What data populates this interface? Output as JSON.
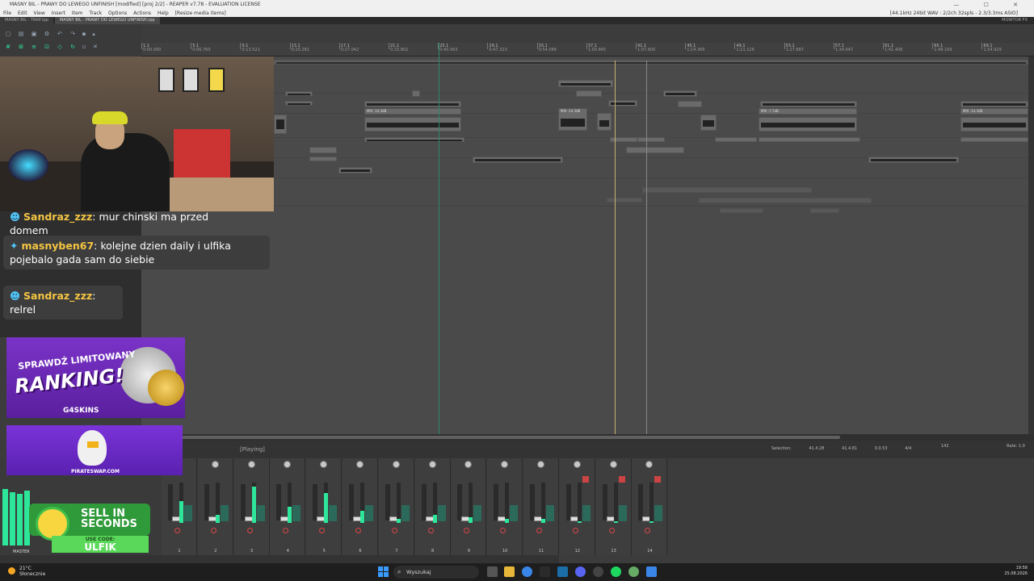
{
  "window": {
    "title": "MASNY BIL - PRAWY DO LEWEGO UNFINISH [modified] [proj 2/2] - REAPER v7.78 - EVALUATION LICENSE",
    "controls": "— ☐ ✕"
  },
  "menu": {
    "items": [
      "File",
      "Edit",
      "View",
      "Insert",
      "Item",
      "Track",
      "Options",
      "Actions",
      "Help",
      "[Resize media items]"
    ],
    "format": "[44.1kHz 24bit WAV : 2/2ch 32spls - 2.3/3.3ms ASIO]"
  },
  "tabs": {
    "items": [
      "MASNY BIL - TRAP.rpp",
      "MASNY BIL - PRAWY DO LEWEGO UNFINISH.rpp"
    ],
    "monitor": "MONITOR FX"
  },
  "ruler": {
    "marks": [
      {
        "bar": "1.1",
        "time": "0:00.000"
      },
      {
        "bar": "5.1",
        "time": "0:06.760"
      },
      {
        "bar": "9.1",
        "time": "0:13.521"
      },
      {
        "bar": "13.1",
        "time": "0:20.281"
      },
      {
        "bar": "17.1",
        "time": "0:27.042"
      },
      {
        "bar": "21.1",
        "time": "0:33.802"
      },
      {
        "bar": "25.1",
        "time": "0:40.563"
      },
      {
        "bar": "29.1",
        "time": "0:47.323"
      },
      {
        "bar": "33.1",
        "time": "0:54.084"
      },
      {
        "bar": "37.1",
        "time": "1:00.845"
      },
      {
        "bar": "41.1",
        "time": "1:07.605"
      },
      {
        "bar": "45.1",
        "time": "1:14.366"
      },
      {
        "bar": "49.1",
        "time": "1:21.126"
      },
      {
        "bar": "53.1",
        "time": "1:27.887"
      },
      {
        "bar": "57.1",
        "time": "1:34.647"
      },
      {
        "bar": "61.1",
        "time": "1:41.408"
      },
      {
        "bar": "65.1",
        "time": "1:48.169"
      },
      {
        "bar": "69.1",
        "time": "1:54.929"
      }
    ]
  },
  "items": {
    "labels": [
      "MIX -14.3dB",
      "MIX -14.3dB",
      "MIX -7.7dB",
      "MIX -14.3dB",
      "MIX -7.7dB",
      "MIX -14.3dB"
    ]
  },
  "transport": {
    "state": "[Playing]",
    "selection_label": "Selection:",
    "sel_start": "41.4.28",
    "sel_end": "41.4.81",
    "sel_len": "0.0.53",
    "sig": "4/4",
    "bpm": "142",
    "rate_label": "Rate:",
    "rate": "1.0"
  },
  "mixer": {
    "master_label": "MASTER",
    "track_numbers": [
      "1",
      "2",
      "3",
      "4",
      "5",
      "6",
      "7",
      "8",
      "9",
      "10",
      "11",
      "12",
      "13",
      "14"
    ],
    "levels": [
      0.55,
      0.2,
      0.9,
      0.4,
      0.75,
      0.3,
      0.1,
      0.2,
      0.15,
      0.1,
      0.1,
      0.05,
      0.05,
      0.05
    ],
    "armed": [
      false,
      false,
      false,
      false,
      false,
      false,
      false,
      false,
      false,
      false,
      false,
      true,
      true,
      true
    ]
  },
  "chat": {
    "messages": [
      {
        "user": "Sandraz_zzz",
        "text": ": mur chinski ma przed domem"
      },
      {
        "user": "masnyben67",
        "text": ": kolejne dzien daily i ulfika pojebalo gada sam do siebie"
      },
      {
        "user": "Sandraz_zzz",
        "text": ": relrel"
      }
    ]
  },
  "ads": {
    "g4_top": "SPRAWDŹ LIMITOWANY",
    "g4_big": "RANKING!",
    "g4_brand": "G4SKINS",
    "pirate": "PIRATESWAP.COM",
    "sell": "SELL IN SECONDS",
    "use_code": "USE CODE:",
    "code": "ULFIK"
  },
  "taskbar": {
    "temp": "21°C",
    "weather": "Słonecznie",
    "search_placeholder": "Wyszukaj",
    "time": "19:58",
    "date": "25.08.2026"
  },
  "colors": {
    "accent": "#2ee69a",
    "play_cursor": "#2a8a6a",
    "edit_cursor": "#c9b070",
    "chat_user": "#f5c542"
  }
}
